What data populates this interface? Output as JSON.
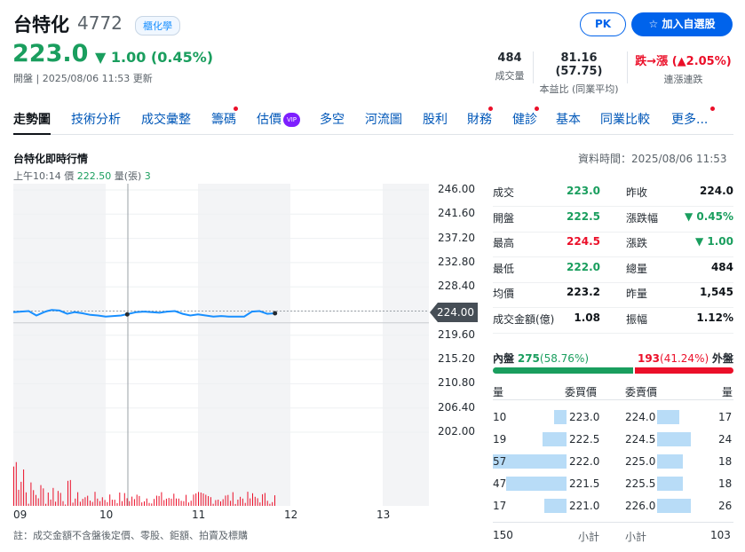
{
  "stock": {
    "name": "台特化",
    "code": "4772",
    "board": "櫃化學",
    "price": "223.0",
    "change": "▼ 1.00 (0.45%)",
    "status": "開盤 | 2025/08/06 11:53 更新"
  },
  "header_buttons": {
    "pk": "PK",
    "add_watchlist": "☆  加入自選股"
  },
  "stats": [
    {
      "value": "484",
      "label": "成交量"
    },
    {
      "value": "81.16 (57.75)",
      "label": "本益比 (同業平均)"
    },
    {
      "value_prefix": "跌→漲 (",
      "value_change": "▲2.05%",
      "value_suffix": ")",
      "label": "連漲連跌"
    }
  ],
  "tabs": [
    "走勢圖",
    "技術分析",
    "成交彙整",
    "籌碼",
    "估價",
    "多空",
    "河流圖",
    "股利",
    "財務",
    "健診",
    "基本",
    "同業比較",
    "更多..."
  ],
  "vip_badge": "VIP",
  "realtime": {
    "title": "台特化即時行情",
    "data_time": "資料時間：2025/08/06 11:53",
    "ticker_time": "上午10:14",
    "ticker_price_label": "價",
    "ticker_price": "222.50",
    "ticker_vol_label": "量(張)",
    "ticker_vol": "3"
  },
  "chart_data": {
    "type": "line",
    "title": "",
    "x_ticks": [
      "09",
      "10",
      "11",
      "12",
      "13"
    ],
    "y_ticks": [
      "246.00",
      "241.60",
      "237.20",
      "232.80",
      "228.40",
      "224.00",
      "219.60",
      "215.20",
      "210.80",
      "206.40",
      "202.00"
    ],
    "ylim": [
      202.0,
      246.0
    ],
    "prev_close": 224.0,
    "last_price_tag": "224.00",
    "series": [
      {
        "x": [
          0,
          5,
          10,
          15,
          20,
          22,
          25,
          30,
          35,
          40,
          45,
          50,
          55,
          60,
          65,
          70,
          75,
          80,
          85,
          90,
          95,
          100,
          105,
          110,
          115,
          120,
          125,
          130,
          135,
          140,
          145,
          150,
          155,
          160,
          165,
          170
        ],
        "y": [
          223.8,
          223.9,
          224.0,
          223.2,
          223.8,
          224.0,
          224.2,
          224.1,
          223.5,
          223.8,
          223.6,
          223.3,
          223.2,
          223.0,
          223.1,
          223.2,
          223.5,
          223.8,
          223.9,
          223.8,
          223.7,
          223.9,
          224.0,
          223.5,
          223.2,
          223.4,
          223.2,
          223.0,
          223.1,
          223.0,
          223.0,
          223.0,
          223.9,
          224.0,
          223.5,
          223.6
        ]
      }
    ],
    "volume_note": "red bars"
  },
  "quote": {
    "rows": [
      {
        "l1": "成交",
        "v1": "223.0",
        "c1": "green",
        "l2": "昨收",
        "v2": "224.0",
        "c2": "dark"
      },
      {
        "l1": "開盤",
        "v1": "222.5",
        "c1": "green",
        "l2": "漲跌幅",
        "v2": "▼ 0.45%",
        "c2": "green"
      },
      {
        "l1": "最高",
        "v1": "224.5",
        "c1": "red",
        "l2": "漲跌",
        "v2": "▼ 1.00",
        "c2": "green"
      },
      {
        "l1": "最低",
        "v1": "222.0",
        "c1": "green",
        "l2": "總量",
        "v2": "484",
        "c2": "dark"
      },
      {
        "l1": "均價",
        "v1": "223.2",
        "c1": "dark",
        "l2": "昨量",
        "v2": "1,545",
        "c2": "dark"
      },
      {
        "l1": "成交金額(億)",
        "v1": "1.08",
        "c1": "dark",
        "l2": "振幅",
        "v2": "1.12%",
        "c2": "dark"
      }
    ]
  },
  "inout": {
    "in_label": "內盤",
    "in_val": "275",
    "in_pct": "(58.76%)",
    "out_val": "193",
    "out_pct": "(41.24%)",
    "out_label": "外盤",
    "in_fraction": 0.5876
  },
  "orderbook": {
    "h_qty": "量",
    "h_bid": "委買價",
    "h_ask": "委賣價",
    "h_qty2": "量",
    "bids": [
      {
        "q": "10",
        "p": "223.0",
        "r": 0.17
      },
      {
        "q": "19",
        "p": "222.5",
        "r": 0.33
      },
      {
        "q": "57",
        "p": "222.0",
        "r": 1.0
      },
      {
        "q": "47",
        "p": "221.5",
        "r": 0.82
      },
      {
        "q": "17",
        "p": "221.0",
        "r": 0.3
      }
    ],
    "asks": [
      {
        "p": "224.0",
        "q": "17",
        "r": 0.65
      },
      {
        "p": "224.5",
        "q": "24",
        "r": 1.0
      },
      {
        "p": "225.0",
        "q": "18",
        "r": 0.75
      },
      {
        "p": "225.5",
        "q": "18",
        "r": 0.75
      },
      {
        "p": "226.0",
        "q": "26",
        "r": 1.0
      }
    ],
    "bid_total": "150",
    "subtotal_label": "小計",
    "ask_total": "103"
  },
  "note": "註：成交金額不含盤後定價、零股、鉅額、拍賣及標購"
}
